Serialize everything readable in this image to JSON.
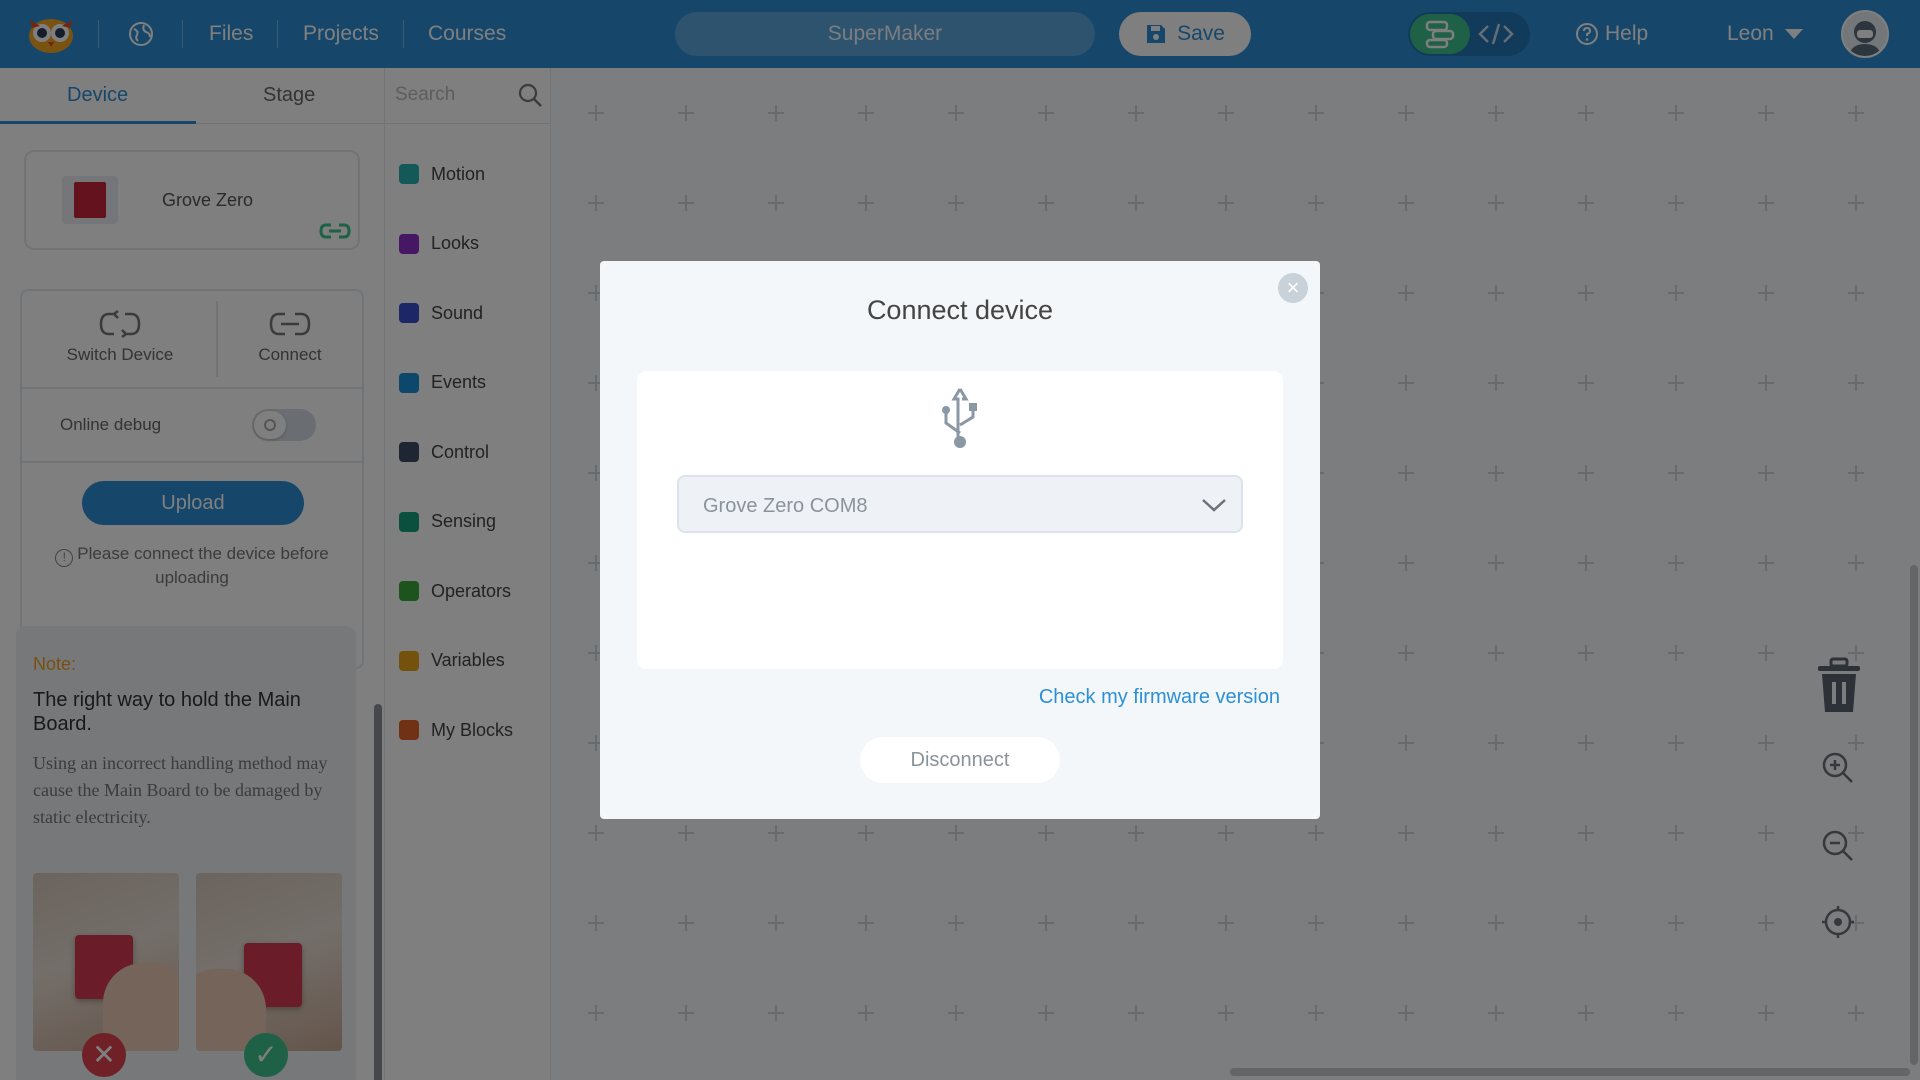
{
  "topbar": {
    "nav": [
      "Files",
      "Projects",
      "Courses"
    ],
    "project_name": "SuperMaker",
    "save_label": "Save",
    "help_label": "Help",
    "user_name": "Leon"
  },
  "left_panel": {
    "tabs": [
      "Device",
      "Stage"
    ],
    "active_tab": "Device",
    "device_name": "Grove Zero",
    "switch_device_label": "Switch Device",
    "connect_label": "Connect",
    "online_debug_label": "Online debug",
    "upload_label": "Upload",
    "upload_hint": "Please connect the device before uploading",
    "note": {
      "title": "Note:",
      "heading": "The right way to hold the Main Board.",
      "body": "Using an incorrect handling method may cause the Main Board to be damaged by static electricity."
    }
  },
  "categories": {
    "search_placeholder": "Search",
    "items": [
      {
        "label": "Motion",
        "color": "#2bb0b0"
      },
      {
        "label": "Looks",
        "color": "#8a2fc9"
      },
      {
        "label": "Sound",
        "color": "#3a4fd0"
      },
      {
        "label": "Events",
        "color": "#1a8fd6"
      },
      {
        "label": "Control",
        "color": "#3d4d66"
      },
      {
        "label": "Sensing",
        "color": "#16a07c"
      },
      {
        "label": "Operators",
        "color": "#3aa63a"
      },
      {
        "label": "Variables",
        "color": "#e8a51a"
      },
      {
        "label": "My Blocks",
        "color": "#e0632a"
      }
    ]
  },
  "modal": {
    "title": "Connect device",
    "port_value": "Grove Zero COM8",
    "firmware_link": "Check my firmware version",
    "disconnect_label": "Disconnect"
  },
  "colors": {
    "accent": "#2d8fd5",
    "blocks_mode": "#3cc28d",
    "note_title": "#f0a020"
  }
}
